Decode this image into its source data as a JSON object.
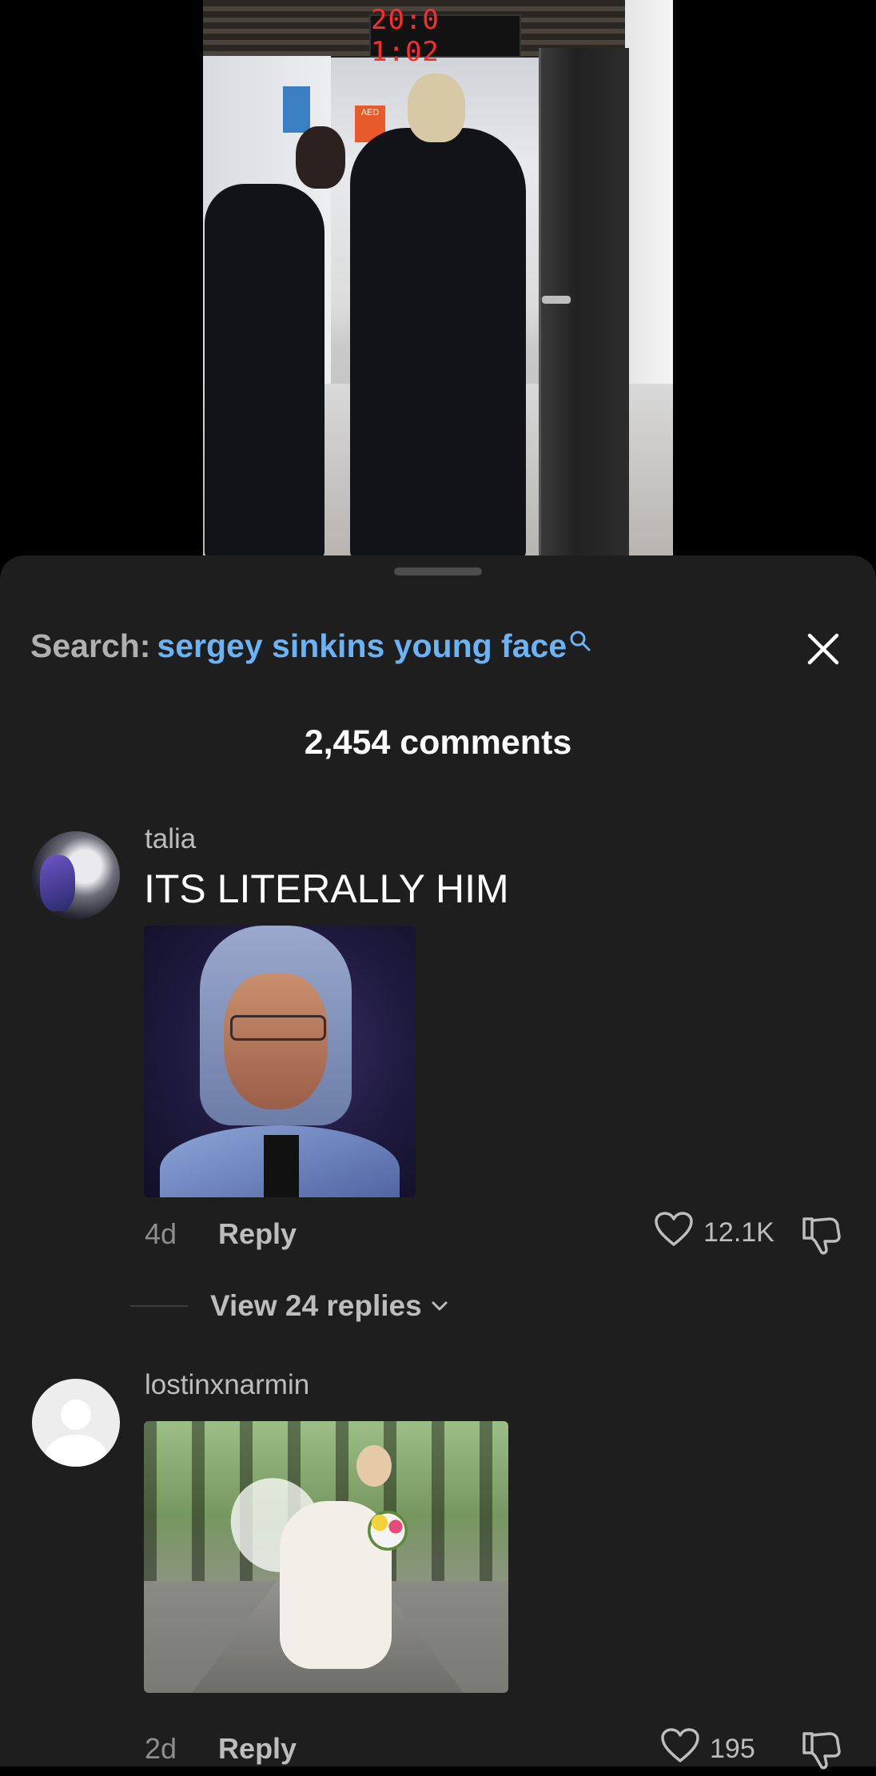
{
  "video": {
    "clock_text": "20:0 1:02",
    "aed_label": "AED"
  },
  "sheet": {
    "search": {
      "label": "Search:",
      "query": "sergey sinkins young face"
    },
    "comment_count": "2,454 comments"
  },
  "comments": [
    {
      "username": "talia",
      "text": "ITS LITERALLY HIM",
      "age": "4d",
      "reply_label": "Reply",
      "likes": "12.1K",
      "view_replies": "View 24 replies"
    },
    {
      "username": "lostinxnarmin",
      "age": "2d",
      "reply_label": "Reply",
      "likes": "195"
    }
  ],
  "icons": {
    "close": "close-icon",
    "search": "search-icon",
    "like": "heart-icon",
    "dislike": "thumbs-down-icon",
    "expand": "chevron-down-icon"
  },
  "colors": {
    "sheet_bg": "#1e1e1e",
    "search_query": "#6ab3f7",
    "muted_text": "#bdbdbd"
  }
}
